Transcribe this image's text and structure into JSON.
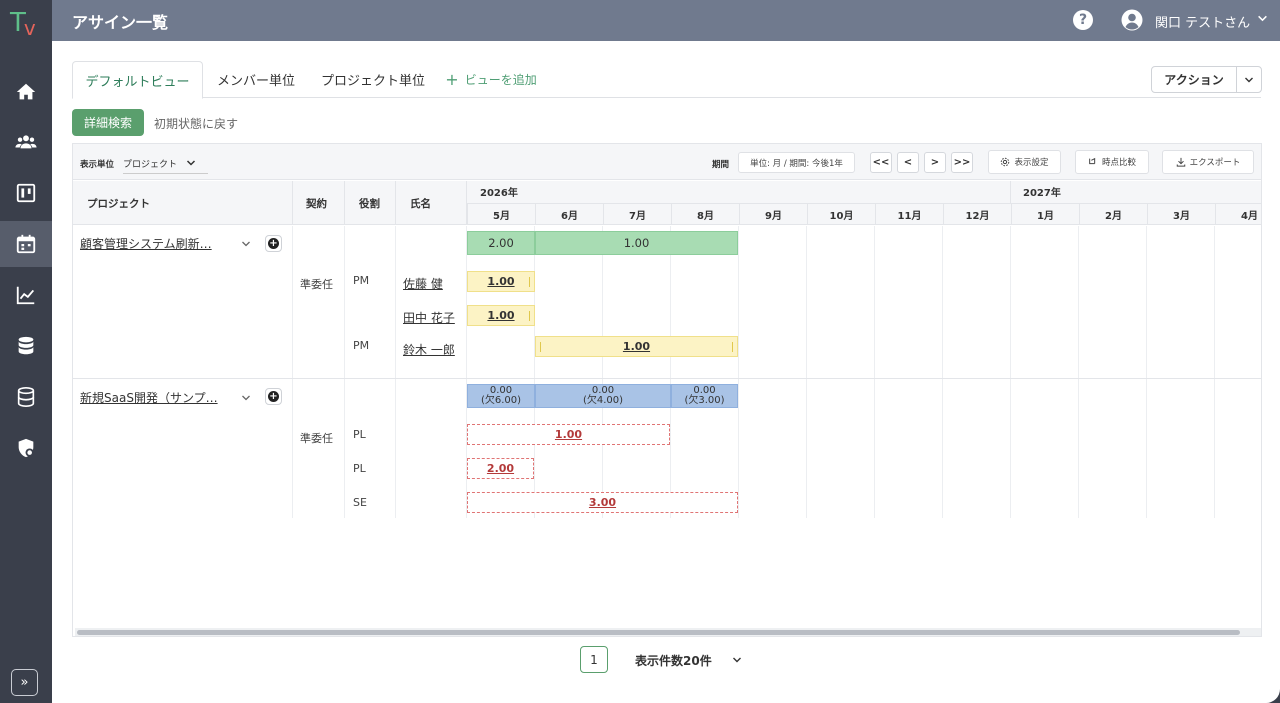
{
  "app": {
    "logo_text": "T",
    "logo_sub": "v"
  },
  "header": {
    "title": "アサイン一覧",
    "help": "?",
    "user_name": "関口 テストさん"
  },
  "rail": {
    "expand": "»"
  },
  "tabs": [
    {
      "label": "デフォルトビュー",
      "active": true
    },
    {
      "label": "メンバー単位"
    },
    {
      "label": "プロジェクト単位"
    },
    {
      "label": "ビューを追加",
      "icon": "plus-icon"
    }
  ],
  "actions": {
    "label": "アクション"
  },
  "filter": {
    "search_label": "詳細検索",
    "reset_label": "初期状態に戻す"
  },
  "toolbar": {
    "unit_label": "表示単位",
    "unit_value": "プロジェクト",
    "period_label": "期間",
    "period_value": "単位: 月 / 期間: 今後1年",
    "nav": [
      "<<",
      "<",
      ">",
      ">>"
    ],
    "display_settings": "表示設定",
    "compare": "時点比較",
    "export": "エクスポート"
  },
  "columns": {
    "project": "プロジェクト",
    "contract": "契約",
    "role": "役割",
    "name": "氏名"
  },
  "years": [
    "2026年",
    "2027年"
  ],
  "months": [
    "5月",
    "6月",
    "7月",
    "8月",
    "9月",
    "10月",
    "11月",
    "12月",
    "1月",
    "2月",
    "3月",
    "4月"
  ],
  "projects": [
    {
      "name": "顧客管理システム刷新…",
      "contract": "準委任",
      "summary": [
        "2.00",
        "1.00"
      ],
      "rows": [
        {
          "role": "PM",
          "member": "佐藤 健",
          "value": "1.00"
        },
        {
          "role": "",
          "member": "田中 花子",
          "value": "1.00"
        },
        {
          "role": "PM",
          "member": "鈴木 一郎",
          "value": "1.00"
        }
      ]
    },
    {
      "name": "新規SaaS開発（サンプ…",
      "contract": "準委任",
      "summary": [
        {
          "value": "0.00",
          "note": "(欠6.00)"
        },
        {
          "value": "0.00",
          "note": "(欠4.00)"
        },
        {
          "value": "0.00",
          "note": "(欠3.00)"
        }
      ],
      "rows": [
        {
          "role": "PL",
          "value": "1.00"
        },
        {
          "role": "PL",
          "value": "2.00"
        },
        {
          "role": "SE",
          "value": "3.00"
        }
      ]
    }
  ],
  "pagination": {
    "page": "1",
    "per_page": "表示件数20件"
  },
  "colors": {
    "accent": "#5a9f6d",
    "header": "#707a8e",
    "rail": "#3a3f4b"
  }
}
